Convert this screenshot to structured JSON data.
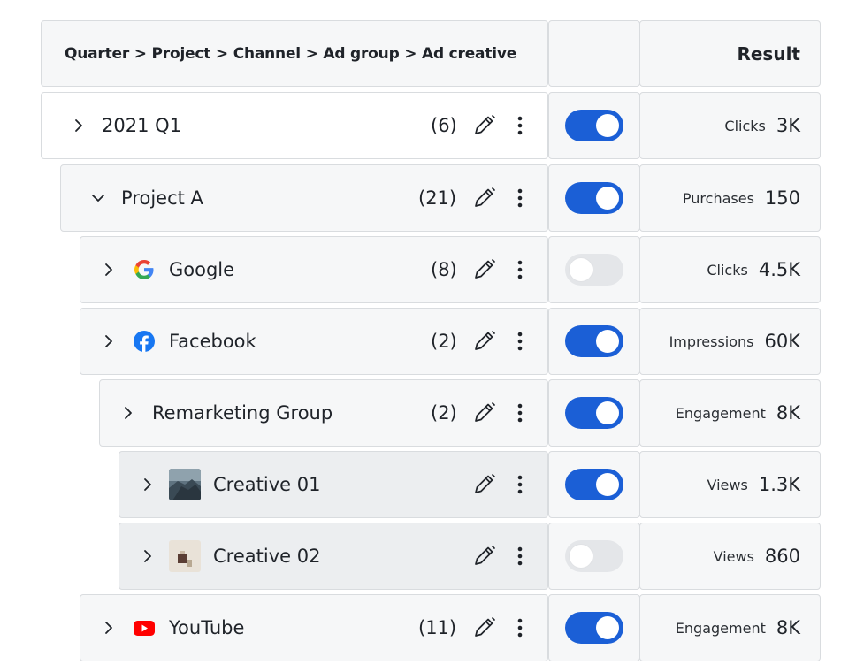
{
  "header": {
    "hierarchy_label": "Quarter > Project > Channel > Ad group > Ad creative",
    "result_label": "Result"
  },
  "rows": [
    {
      "label": "2021 Q1",
      "count": "(6)",
      "metric": "Clicks",
      "value": "3K",
      "enabled": true,
      "expanded": false,
      "icon": "chevron-right-icon"
    },
    {
      "label": "Project A",
      "count": "(21)",
      "metric": "Purchases",
      "value": "150",
      "enabled": true,
      "expanded": true,
      "icon": "chevron-down-icon"
    },
    {
      "label": "Google",
      "count": "(8)",
      "metric": "Clicks",
      "value": "4.5K",
      "enabled": false,
      "expanded": false,
      "icon": "google-icon"
    },
    {
      "label": "Facebook",
      "count": "(2)",
      "metric": "Impressions",
      "value": "60K",
      "enabled": true,
      "expanded": false,
      "icon": "facebook-icon"
    },
    {
      "label": "Remarketing Group",
      "count": "(2)",
      "metric": "Engagement",
      "value": "8K",
      "enabled": true,
      "expanded": false,
      "icon": "chevron-right-icon"
    },
    {
      "label": "Creative 01",
      "count": "",
      "metric": "Views",
      "value": "1.3K",
      "enabled": true,
      "expanded": false,
      "icon": "creative-thumbnail-icon"
    },
    {
      "label": "Creative 02",
      "count": "",
      "metric": "Views",
      "value": "860",
      "enabled": false,
      "expanded": false,
      "icon": "creative-thumbnail-icon"
    },
    {
      "label": "YouTube",
      "count": "(11)",
      "metric": "Engagement",
      "value": "8K",
      "enabled": true,
      "expanded": false,
      "icon": "youtube-icon"
    }
  ],
  "colors": {
    "toggle_on": "#1b5fd6",
    "toggle_off": "#e4e6e9",
    "google_blue": "#4285f4",
    "google_red": "#ea4335",
    "google_yellow": "#fbbc05",
    "google_green": "#34a853",
    "facebook_blue": "#1877f2",
    "youtube_red": "#ff0000"
  }
}
